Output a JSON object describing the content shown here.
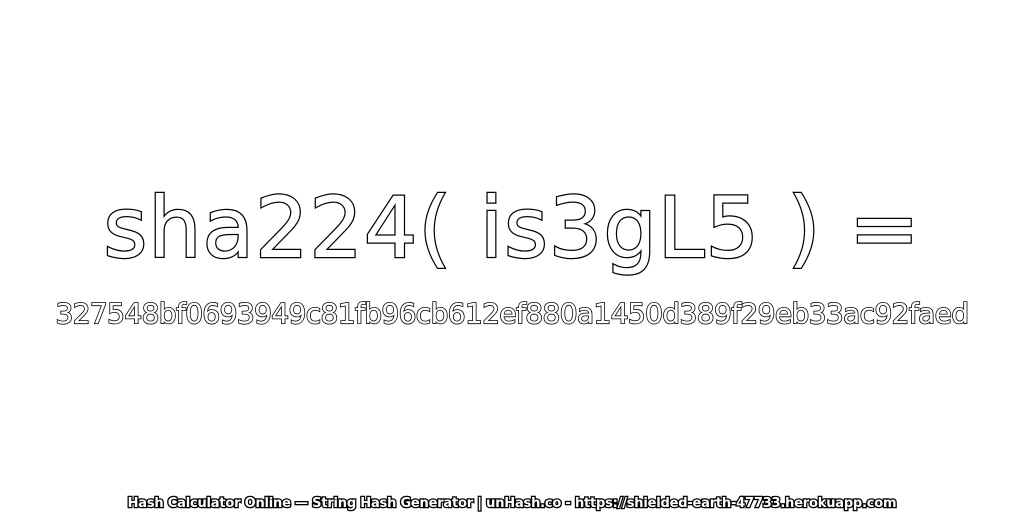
{
  "headline": "sha224( is3gL5 ) =",
  "hash_value": "327548bf0693949c81fb96cb612ef880a1450d389f29eb33ac92faed",
  "footer": "Hash Calculator Online — String Hash Generator | unHash.co - https://shielded-earth-47733.herokuapp.com",
  "colors": {
    "background": "#ffffff",
    "text_fill": "#ffffff",
    "text_outline": "#000000"
  }
}
